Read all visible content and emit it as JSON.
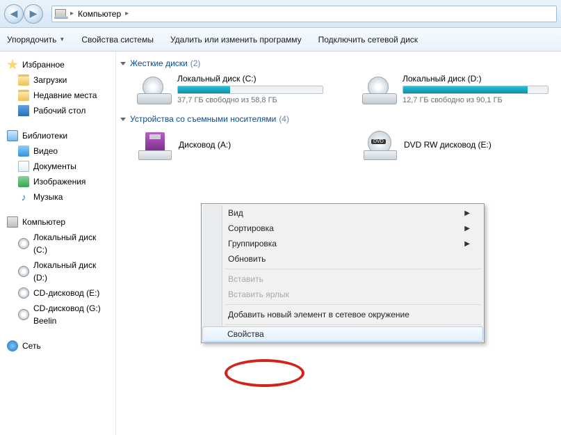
{
  "address": {
    "root": "Компьютер"
  },
  "toolbar": {
    "organize": "Упорядочить",
    "props": "Свойства системы",
    "remove": "Удалить или изменить программу",
    "netdrive": "Подключить сетевой диск"
  },
  "sidebar": {
    "favorites": "Избранное",
    "downloads": "Загрузки",
    "recent": "Недавние места",
    "desktop": "Рабочий стол",
    "libraries": "Библиотеки",
    "video": "Видео",
    "documents": "Документы",
    "pictures": "Изображения",
    "music": "Музыка",
    "computer": "Компьютер",
    "local_c": "Локальный диск (C:)",
    "local_d": "Локальный диск (D:)",
    "cd_e": "CD-дисковод (E:)",
    "cd_g": "CD-дисковод (G:) Beelin",
    "network": "Сеть"
  },
  "groups": {
    "hdd": {
      "label": "Жесткие диски",
      "count": "(2)"
    },
    "removable": {
      "label": "Устройства со съемными носителями",
      "count": "(4)"
    }
  },
  "drives": {
    "c": {
      "name": "Локальный диск (C:)",
      "sub": "37,7 ГБ свободно из 58,8 ГБ",
      "fill": 36
    },
    "d": {
      "name": "Локальный диск (D:)",
      "sub": "12,7 ГБ свободно из 90,1 ГБ",
      "fill": 86
    },
    "a": {
      "name": "Дисковод (A:)"
    },
    "e": {
      "name": "DVD RW дисковод (E:)"
    }
  },
  "ctx": {
    "view": "Вид",
    "sort": "Сортировка",
    "group": "Группировка",
    "refresh": "Обновить",
    "paste": "Вставить",
    "paste_lnk": "Вставить ярлык",
    "add_net": "Добавить новый элемент в сетевое окружение",
    "props": "Свойства"
  }
}
